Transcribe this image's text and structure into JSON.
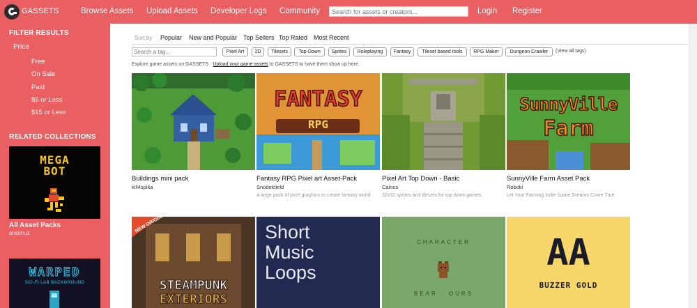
{
  "nav": {
    "brand": "GASSETS",
    "links": [
      "Browse Assets",
      "Upload Assets",
      "Developer Logs",
      "Community"
    ],
    "search_placeholder": "Search for assets or creators...",
    "login": "Login",
    "register": "Register"
  },
  "sidebar": {
    "filter_heading": "FILTER RESULTS",
    "price_label": "Price",
    "price_filters": [
      "Free",
      "On Sale",
      "Paid",
      "$5 or Less",
      "$15 or Less"
    ],
    "collections_heading": "RELATED COLLECTIONS",
    "collections": [
      {
        "title": "All Asset Packs",
        "author": "ansimuz",
        "art_lines": [
          "MEGA",
          "BOT"
        ]
      },
      {
        "title": "",
        "author": "",
        "art_lines": [
          "WARPED",
          "SCI-FI LAB BACKGROUND"
        ]
      }
    ]
  },
  "sort": {
    "label": "Sort by",
    "options": [
      "Popular",
      "New and Popular",
      "Top Sellers",
      "Top Rated",
      "Most Recent"
    ]
  },
  "tags": {
    "search_placeholder": "Search a tag...",
    "items": [
      "Pixel Art",
      "2D",
      "Tilesets",
      "Top-Down",
      "Sprites",
      "Roleplaying",
      "Fantasy",
      "Tileset based tools",
      "RPG Maker",
      "Dungeon Crawler"
    ],
    "view_all": "(View all tags)"
  },
  "explore": {
    "before": "Explore game assets on GASSETS · ",
    "link": "Upload your game assets",
    "after": " to GASSETS to have them show up here."
  },
  "cards": [
    {
      "title": "Buildings mini pack",
      "author": "kill4spika",
      "desc": ""
    },
    {
      "title": "Fantasy RPG Pixel art Asset-Pack",
      "author": "Snodekfield",
      "desc": "A large pack of pixel graphics to create fantasy world",
      "art_lines": [
        "FANTASY",
        "RPG"
      ]
    },
    {
      "title": "Pixel Art Top Down - Basic",
      "author": "Cainos",
      "desc": "32x32 sprites and tilesets for top down games"
    },
    {
      "title": "SunnyVille Farm Asset Pack",
      "author": "Roboki",
      "desc": "Let Your Farming Indie Game Dreams Come True",
      "art_lines": [
        "SunnyVille",
        "Farm"
      ]
    }
  ],
  "cards_row2": [
    {
      "art_lines": [
        "STEAMPUNK",
        "EXTERIORS"
      ],
      "badge": "NEW ORIGINAL"
    },
    {
      "art_lines": [
        "Short",
        "Music",
        "Loops"
      ]
    },
    {
      "art_lines": [
        "CHARACTER",
        "BEAR · OURS"
      ]
    },
    {
      "art_lines": [
        "AA",
        "BUZZER GOLD"
      ]
    }
  ],
  "colors": {
    "accent": "#ea5f62",
    "dark": "#2b2b2b"
  }
}
